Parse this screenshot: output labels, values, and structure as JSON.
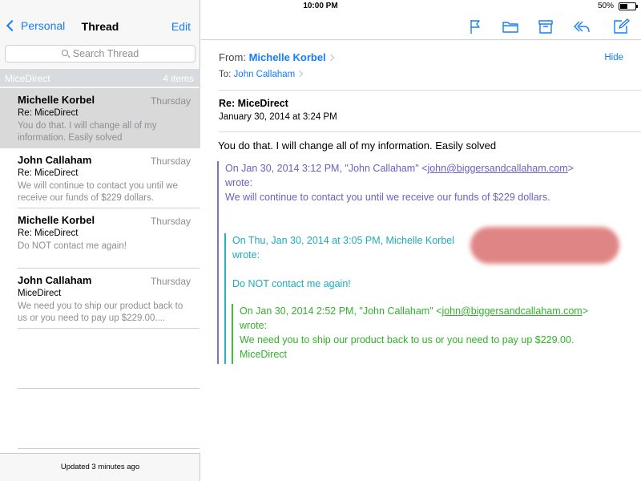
{
  "status_bar": {
    "device": "iPad",
    "time": "10:00 PM",
    "battery": "50%",
    "battery_level": 0.5
  },
  "left_nav": {
    "back_label": "Personal",
    "title": "Thread",
    "edit_label": "Edit"
  },
  "search": {
    "placeholder": "Search Thread"
  },
  "section": {
    "name": "MiceDirect",
    "count": "4 items"
  },
  "messages": [
    {
      "sender": "Michelle Korbel",
      "date": "Thursday",
      "subject": "Re: MiceDirect",
      "preview": "You do that. I will change all of my information. Easily solved",
      "selected": true
    },
    {
      "sender": "John Callaham",
      "date": "Thursday",
      "subject": "Re: MiceDirect",
      "preview": "We will continue to contact you until we receive our funds of $229 dollars.",
      "selected": false
    },
    {
      "sender": "Michelle Korbel",
      "date": "Thursday",
      "subject": "Re: MiceDirect",
      "preview": "Do NOT contact me again!",
      "selected": false
    },
    {
      "sender": "John Callaham",
      "date": "Thursday",
      "subject": "MiceDirect",
      "preview": "We need you to ship our product back to us or you need to pay up $229.00....",
      "selected": false
    }
  ],
  "footer": {
    "updated": "Updated 3 minutes ago"
  },
  "toolbar": {
    "icons": [
      "flag-icon",
      "folder-icon",
      "archive-icon",
      "reply-icon",
      "compose-icon"
    ]
  },
  "email": {
    "from_label": "From:",
    "from_name": "Michelle Korbel",
    "to_label": "To:",
    "to_name": "John Callaham",
    "hide_label": "Hide",
    "subject": "Re: MiceDirect",
    "date": "January 30, 2014 at 3:24 PM",
    "body": "You do that. I will change all of my information. Easily solved",
    "quote1": {
      "header": "On Jan 30, 2014 3:12 PM, \"John Callaham\" <",
      "email": "john@biggersandcallaham.com",
      "header_end": ">",
      "wrote": "wrote:",
      "text": "We will continue to contact you until we receive our funds of $229 dollars."
    },
    "quote2": {
      "header": "On Thu, Jan 30, 2014 at 3:05 PM, Michelle Korbel",
      "wrote": "wrote:",
      "text": "Do NOT contact me again!"
    },
    "quote3": {
      "header": "On Jan 30, 2014 2:52 PM, \"John Callaham\" <",
      "email": "john@biggersandcallaham.com",
      "header_end": ">",
      "wrote": "wrote:",
      "text": "We need you to ship our product back to us or you need to pay up $229.00.",
      "signature": "MiceDirect"
    }
  },
  "colors": {
    "accent": "#147efb",
    "quote1": "#6a60c0",
    "quote2": "#1faabc",
    "quote3": "#32b12a",
    "redaction": "#e08585"
  }
}
